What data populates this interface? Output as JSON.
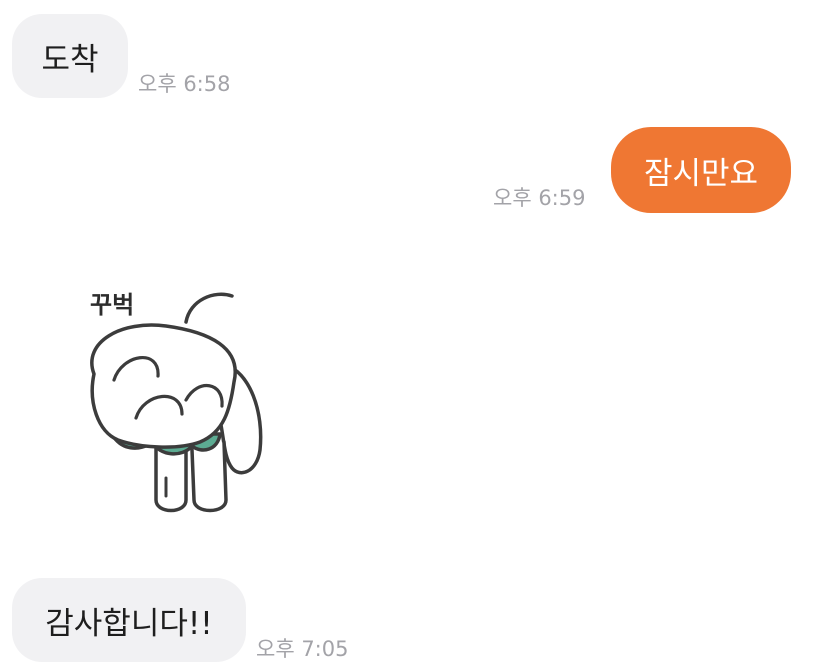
{
  "messages": [
    {
      "direction": "incoming",
      "type": "text",
      "text": "도착",
      "time": "오후 6:58"
    },
    {
      "direction": "outgoing",
      "type": "text",
      "text": "잠시만요",
      "time": "오후 6:59"
    },
    {
      "direction": "incoming",
      "type": "sticker",
      "sticker_text": "꾸벅",
      "icon": "bowing-bunny-sticker"
    },
    {
      "direction": "incoming",
      "type": "text",
      "text": "감사합니다!!",
      "time": "오후 7:05"
    }
  ],
  "colors": {
    "incoming_bubble": "#f1f1f3",
    "outgoing_bubble": "#ef7733",
    "timestamp": "#a3a3a8",
    "sticker_accent": "#5cab92"
  }
}
